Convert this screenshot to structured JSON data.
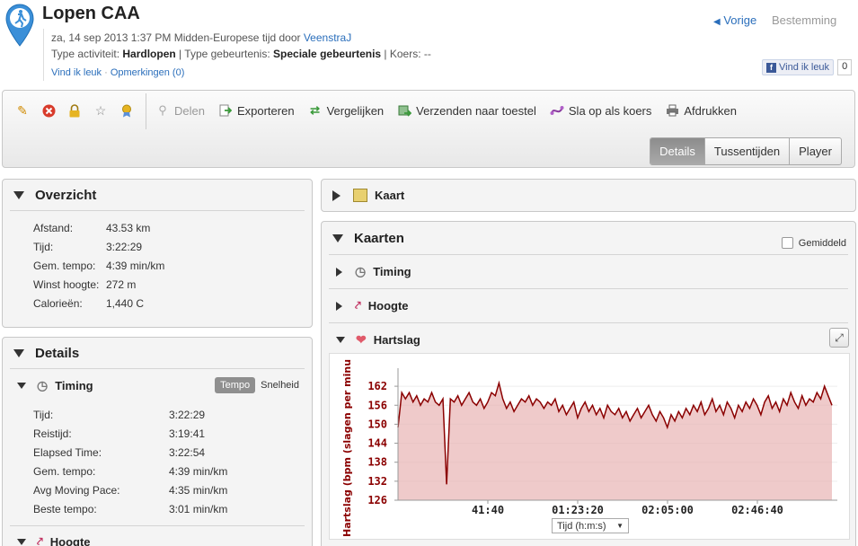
{
  "header": {
    "title": "Lopen CAA",
    "date_prefix": "za, 14 sep 2013 1:37 PM Midden-Europese tijd door ",
    "author": "VeenstraJ",
    "type_label": "Type activiteit: ",
    "type_value": "Hardlopen",
    "event_label": " | Type gebeurtenis: ",
    "event_value": "Speciale gebeurtenis",
    "course_label": " | Koers: --",
    "like_link": "Vind ik leuk",
    "dot": " · ",
    "comments_link": "Opmerkingen (0)",
    "prev": "Vorige",
    "next": "Bestemming",
    "fb_label": "Vind ik leuk",
    "fb_count": "0"
  },
  "toolbar": {
    "items": [
      "Delen",
      "Exporteren",
      "Vergelijken",
      "Verzenden naar toestel",
      "Sla op als koers",
      "Afdrukken"
    ],
    "tabs": [
      "Details",
      "Tussentijden",
      "Player"
    ]
  },
  "overview": {
    "title": "Overzicht",
    "rows": [
      {
        "k": "Afstand:",
        "v": "43.53 km"
      },
      {
        "k": "Tijd:",
        "v": "3:22:29"
      },
      {
        "k": "Gem. tempo:",
        "v": "4:39 min/km"
      },
      {
        "k": "Winst hoogte:",
        "v": "272 m"
      },
      {
        "k": "Calorieën:",
        "v": "1,440 C"
      }
    ]
  },
  "details": {
    "title": "Details",
    "timing_title": "Timing",
    "pill_tempo": "Tempo",
    "pill_speed": "Snelheid",
    "rows": [
      {
        "k": "Tijd:",
        "v": "3:22:29"
      },
      {
        "k": "Reistijd:",
        "v": "3:19:41"
      },
      {
        "k": "Elapsed Time:",
        "v": "3:22:54"
      },
      {
        "k": "Gem. tempo:",
        "v": "4:39 min/km"
      },
      {
        "k": "Avg Moving Pace:",
        "v": "4:35 min/km"
      },
      {
        "k": "Beste tempo:",
        "v": "3:01 min/km"
      }
    ],
    "next_section": "Hoogte"
  },
  "map": {
    "title": "Kaart"
  },
  "charts": {
    "title": "Kaarten",
    "avg_label": "Gemiddeld",
    "sections": [
      "Timing",
      "Hoogte",
      "Hartslag"
    ],
    "x_select": "Tijd (h:m:s)"
  },
  "chart_data": {
    "type": "area",
    "ylabel": "Hartslag (bpm (slagen per minu",
    "xlabel": "Tijd (h:m:s)",
    "yticks": [
      162,
      156,
      150,
      144,
      138,
      132,
      126
    ],
    "xticks": [
      "41:40",
      "01:23:20",
      "02:05:00",
      "02:46:40"
    ],
    "ylim": [
      126,
      166
    ],
    "color": "#8b0000",
    "fill": "#e8b4b4",
    "series": [
      {
        "values": [
          149,
          160,
          158,
          160,
          157,
          159,
          156,
          158,
          157,
          160,
          157,
          156,
          158,
          131,
          158,
          157,
          159,
          156,
          158,
          160,
          157,
          156,
          158,
          155,
          157,
          160,
          159,
          163,
          158,
          155,
          157,
          154,
          156,
          158,
          157,
          159,
          156,
          158,
          157,
          155,
          157,
          156,
          158,
          154,
          156,
          153,
          155,
          157,
          152,
          155,
          157,
          154,
          156,
          153,
          155,
          152,
          156,
          154,
          153,
          155,
          152,
          154,
          151,
          153,
          155,
          152,
          154,
          156,
          153,
          151,
          154,
          152,
          149,
          153,
          151,
          154,
          152,
          155,
          153,
          156,
          154,
          157,
          153,
          155,
          158,
          154,
          156,
          153,
          157,
          155,
          152,
          156,
          154,
          157,
          155,
          158,
          156,
          153,
          157,
          159,
          155,
          157,
          154,
          158,
          156,
          160,
          157,
          155,
          159,
          156,
          158,
          157,
          160,
          158,
          162,
          159,
          156
        ]
      }
    ]
  }
}
